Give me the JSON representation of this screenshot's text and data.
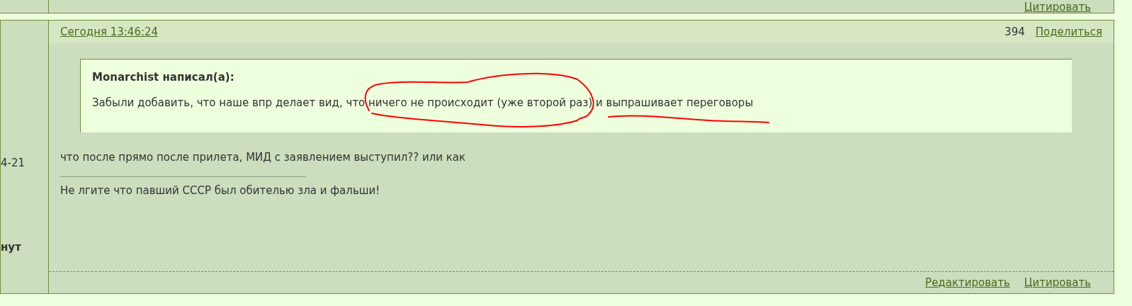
{
  "previous_post": {
    "footer_links": [
      "Цитировать"
    ]
  },
  "post": {
    "author_lines": [
      {
        "text": "4-21",
        "bold": false
      },
      {
        "text": "нут",
        "bold": true
      }
    ],
    "date": "Сегодня 13:46:24",
    "number": "394",
    "share": "Поделиться",
    "quote": {
      "author": "Monarchist написал(а):",
      "text": "Забыли добавить, что наше впр делает вид, что ничего не происходит (уже второй раз) и выпрашивает переговоры"
    },
    "body": "что после прямо после прилета, МИД с заявлением выступил?? или как",
    "signature": "Не лгите что павший СССР был обителью зла и фальши!",
    "footer_links": [
      "Редактировать",
      "Цитировать"
    ]
  }
}
